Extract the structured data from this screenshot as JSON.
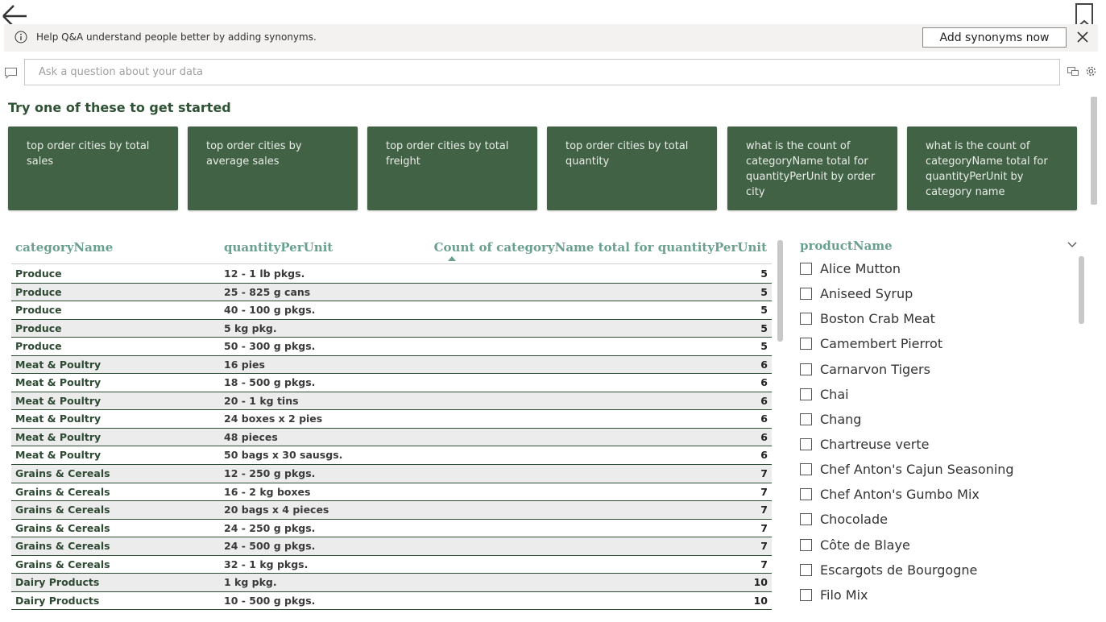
{
  "nav": {
    "back_icon": "back-arrow-icon",
    "bookmark_icon": "bookmark-icon"
  },
  "banner": {
    "info_icon": "info-icon",
    "text": "Help Q&A understand people better by adding synonyms.",
    "button_label": "Add synonyms now",
    "close_icon": "close-icon"
  },
  "search": {
    "placeholder": "Ask a question about your data",
    "value": ""
  },
  "suggestions": {
    "heading": "Try one of these to get started",
    "cards": [
      "top order cities by total sales",
      "top order cities by average sales",
      "top order cities by total freight",
      "top order cities by total quantity",
      "what is the count of categoryName total for quantityPerUnit by order city",
      "what is the count of categoryName total for quantityPerUnit by category name"
    ]
  },
  "table": {
    "columns": [
      "categoryName",
      "quantityPerUnit",
      "Count of categoryName total for quantityPerUnit"
    ],
    "sorted_column": "Count of categoryName total for quantityPerUnit",
    "sort_direction": "ascending",
    "rows": [
      [
        "Produce",
        "12 - 1 lb pkgs.",
        "5"
      ],
      [
        "Produce",
        "25 - 825 g cans",
        "5"
      ],
      [
        "Produce",
        "40 - 100 g pkgs.",
        "5"
      ],
      [
        "Produce",
        "5 kg pkg.",
        "5"
      ],
      [
        "Produce",
        "50 - 300 g pkgs.",
        "5"
      ],
      [
        "Meat & Poultry",
        "16 pies",
        "6"
      ],
      [
        "Meat & Poultry",
        "18 - 500 g pkgs.",
        "6"
      ],
      [
        "Meat & Poultry",
        "20 - 1 kg tins",
        "6"
      ],
      [
        "Meat & Poultry",
        "24 boxes x 2 pies",
        "6"
      ],
      [
        "Meat & Poultry",
        "48 pieces",
        "6"
      ],
      [
        "Meat & Poultry",
        "50 bags x 30 sausgs.",
        "6"
      ],
      [
        "Grains & Cereals",
        "12 - 250 g pkgs.",
        "7"
      ],
      [
        "Grains & Cereals",
        "16 - 2 kg boxes",
        "7"
      ],
      [
        "Grains & Cereals",
        "20 bags x 4 pieces",
        "7"
      ],
      [
        "Grains & Cereals",
        "24 - 250 g pkgs.",
        "7"
      ],
      [
        "Grains & Cereals",
        "24 - 500 g pkgs.",
        "7"
      ],
      [
        "Grains & Cereals",
        "32 - 1 kg pkgs.",
        "7"
      ],
      [
        "Dairy Products",
        "1 kg pkg.",
        "10"
      ],
      [
        "Dairy Products",
        "10 - 500 g pkgs.",
        "10"
      ]
    ]
  },
  "slicer": {
    "title": "productName",
    "items": [
      "Alice Mutton",
      "Aniseed Syrup",
      "Boston Crab Meat",
      "Camembert Pierrot",
      "Carnarvon Tigers",
      "Chai",
      "Chang",
      "Chartreuse verte",
      "Chef Anton's Cajun Seasoning",
      "Chef Anton's Gumbo Mix",
      "Chocolade",
      "Côte de Blaye",
      "Escargots de Bourgogne",
      "Filo Mix"
    ]
  },
  "colors": {
    "card_bg": "#426246",
    "heading_green": "#2f5234",
    "header_teal": "#6aa08d",
    "row_alt": "#ececec"
  }
}
